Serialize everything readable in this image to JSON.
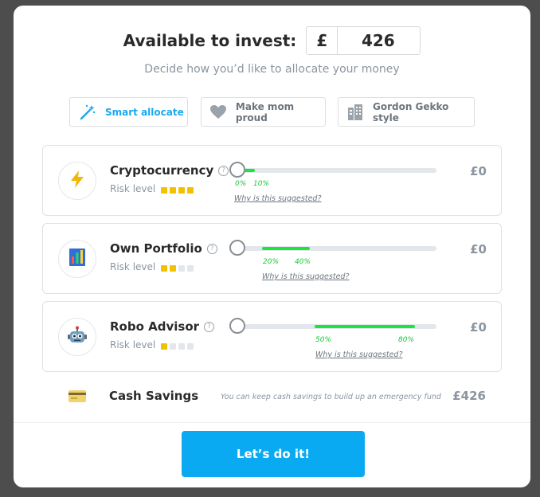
{
  "header": {
    "title": "Available to invest:",
    "currency_symbol": "£",
    "amount": "426",
    "subtitle": "Decide how you’d like to allocate your money"
  },
  "presets": [
    {
      "label": "Smart allocate",
      "icon": "magic-wand-icon",
      "active": true
    },
    {
      "label": "Make mom proud",
      "icon": "heart-icon",
      "active": false
    },
    {
      "label": "Gordon Gekko style",
      "icon": "building-icon",
      "active": false
    }
  ],
  "cards": [
    {
      "name": "Cryptocurrency",
      "icon": "lightning-icon",
      "risk_label": "Risk level",
      "risk_level": 4,
      "risk_max": 4,
      "suggested_min": "0%",
      "suggested_max": "10%",
      "suggested_range": [
        0,
        10
      ],
      "current_allocation_percent": 0,
      "why_link": "Why is this suggested?",
      "amount": "£0"
    },
    {
      "name": "Own Portfolio",
      "icon": "bar-chart-icon",
      "risk_label": "Risk level",
      "risk_level": 2,
      "risk_max": 4,
      "suggested_min": "20%",
      "suggested_max": "40%",
      "suggested_range": [
        20,
        40
      ],
      "current_allocation_percent": 0,
      "why_link": "Why is this suggested?",
      "amount": "£0"
    },
    {
      "name": "Robo Advisor",
      "icon": "robot-icon",
      "risk_label": "Risk level",
      "risk_level": 1,
      "risk_max": 4,
      "suggested_min": "50%",
      "suggested_max": "80%",
      "suggested_range": [
        50,
        80
      ],
      "current_allocation_percent": 0,
      "why_link": "Why is this suggested?",
      "amount": "£0"
    }
  ],
  "cash": {
    "name": "Cash Savings",
    "icon": "credit-card-icon",
    "note": "You can keep cash savings to build up an emergency fund",
    "amount": "£426"
  },
  "cta": {
    "label": "Let’s do it!"
  },
  "colors": {
    "accent": "#0aaaf3",
    "range": "#19e63c",
    "risk": "#f2c200"
  }
}
